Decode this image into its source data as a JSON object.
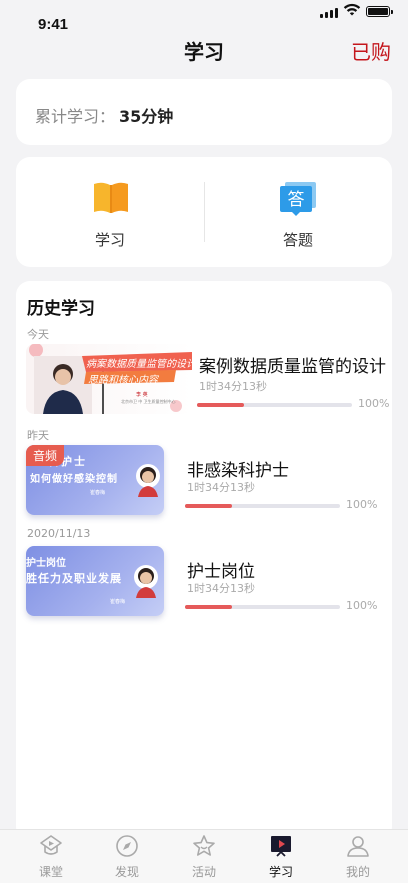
{
  "status_bar": {
    "time": "9:41"
  },
  "header": {
    "title": "学习",
    "purchased_label": "已购"
  },
  "summary": {
    "label": "累计学习：",
    "value": "35分钟"
  },
  "menu": [
    {
      "label": "学习",
      "icon": "book-icon"
    },
    {
      "label": "答题",
      "icon": "answer-icon",
      "icon_text": "答"
    }
  ],
  "history": {
    "title": "历史学习",
    "groups": [
      {
        "date": "今天",
        "item": {
          "title": "案例数据质量监管的设计",
          "duration": "1时34分13秒",
          "progress_pct": "100%",
          "progress_fill": 0.3,
          "thumb_text": [
            "病案数据质量监管的设计",
            "思路和核心内容"
          ],
          "thumb_caption": "李 英",
          "thumb_caption2": "北京市卫 中 卫生质量控制中心"
        }
      },
      {
        "date": "昨天",
        "item": {
          "title": "非感染科护士",
          "duration": "1时34分13秒",
          "progress_pct": "100%",
          "progress_fill": 0.3,
          "badge": "音频",
          "thumb_text": [
            "科护士",
            "如何做好感染控制"
          ],
          "thumb_caption": "崔春梅"
        }
      },
      {
        "date": "2020/11/13",
        "item": {
          "title": "护士岗位",
          "duration": "1时34分13秒",
          "progress_pct": "100%",
          "progress_fill": 0.3,
          "thumb_text": [
            "护士岗位",
            "胜任力及职业发展"
          ],
          "thumb_caption": "崔春梅"
        }
      }
    ]
  },
  "tabbar": [
    {
      "label": "课堂",
      "icon": "classroom-icon",
      "active": false
    },
    {
      "label": "发现",
      "icon": "compass-icon",
      "active": false
    },
    {
      "label": "活动",
      "icon": "star-icon",
      "active": false
    },
    {
      "label": "学习",
      "icon": "study-play-icon",
      "active": true
    },
    {
      "label": "我的",
      "icon": "user-icon",
      "active": false
    }
  ],
  "colors": {
    "accent": "#c4161c",
    "progress": "#e55a5a",
    "menu_orange": "#f5a623",
    "menu_blue": "#2d9be8"
  }
}
